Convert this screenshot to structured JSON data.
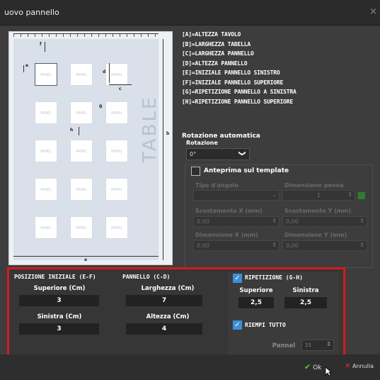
{
  "window": {
    "title": "uovo pannello",
    "close_icon": "×"
  },
  "legend": [
    "[A]=ALTEZZA TAVOLO",
    "[B]=LARGHEZZA TABELLA",
    "[C]=LARGHEZZA PANNELLO",
    "[D]=ALTEZZA PANNELLO",
    "[E]=INIZIALE PANNELLO SINISTRO",
    "[F]=INIZIALE PANNELLO SUPERIORE",
    "[G]=RIPETIZIONE PANNELLO A SINISTRA",
    "[H]=RIPETIZIONE PANNELLO SUPERIORE"
  ],
  "preview": {
    "table_word": "TABLE",
    "panel_text": "PANEL",
    "labels": {
      "a": "a",
      "b": "b",
      "c": "c",
      "d": "d",
      "e": "e",
      "f": "f",
      "g": "g",
      "h": "h"
    }
  },
  "rotation": {
    "title": "Rotazione automatica",
    "label": "Rotazione",
    "value": "0°",
    "chevron": "❯"
  },
  "template_preview": {
    "label": "Anteprima sul template",
    "checked": false,
    "corner_type_label": "Tipo d'angolo",
    "pen_size_label": "Dimensione penna",
    "pen_size_value": "1",
    "offset_x_label": "Scostamento X (mm)",
    "offset_x_value": "0,00",
    "offset_y_label": "Scostamento Y (mm)",
    "offset_y_value": "0,00",
    "dim_x_label": "Dimensione X (mm)",
    "dim_x_value": "0,00",
    "dim_y_label": "Dimensione Y (mm)",
    "dim_y_value": "0,00"
  },
  "initial_position": {
    "title": "POSIZIONE INIZIALE (E-F)",
    "top_label": "Superiore (Cm)",
    "top_value": "3",
    "left_label": "Sinistra (Cm)",
    "left_value": "3"
  },
  "panel": {
    "title": "PANNELLO (C-D)",
    "width_label": "Larghezza (Cm)",
    "width_value": "7",
    "height_label": "Altezza (Cm)",
    "height_value": "4"
  },
  "repetition": {
    "title": "RIPETIZIONE (G-H)",
    "checked": true,
    "top_label": "Superiore",
    "top_value": "2,5",
    "left_label": "Sinistra",
    "left_value": "2,5",
    "fill_all_label": "RIEMPI TUTTO",
    "fill_all_checked": true,
    "panel_label": "Pannel",
    "panel_value": "15"
  },
  "footer": {
    "ok_label": "Ok",
    "cancel_label": "Annulla"
  },
  "colors": {
    "highlight_border": "#d7191c",
    "checkbox_on": "#3d8fd8",
    "ok_icon": "#6cc04a",
    "cancel_icon": "#e0302f"
  }
}
